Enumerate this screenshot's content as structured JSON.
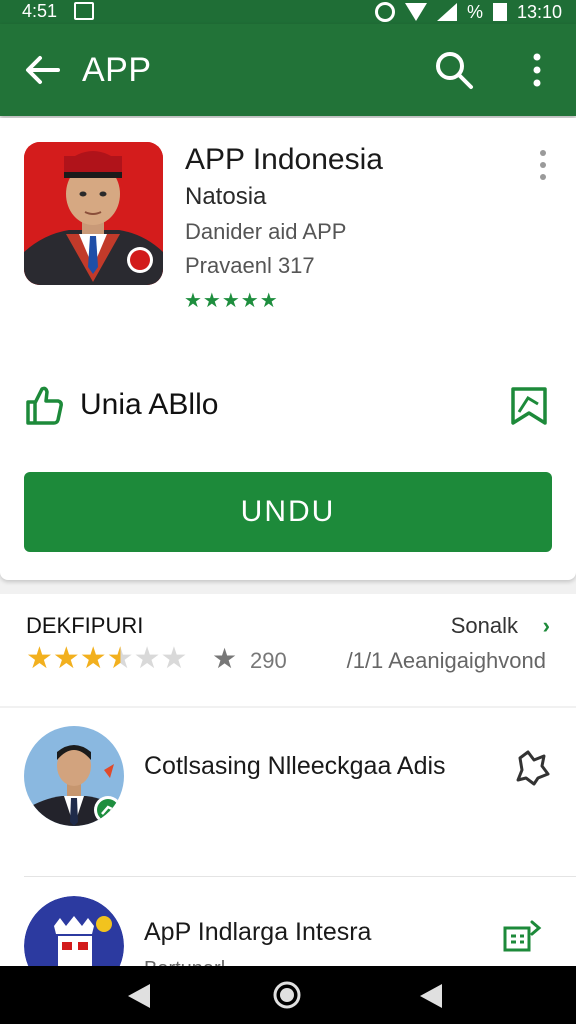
{
  "status_bar": {
    "left_time": "4:51",
    "right_time": "13:10",
    "battery_percent": "%"
  },
  "app_bar": {
    "title": "APP"
  },
  "app_info": {
    "name": "APP Indonesia",
    "developer": "Natosia",
    "subtitle_1": "Danider aid APP",
    "subtitle_2": "Pravaenl 317",
    "star_rating": "★★★★★",
    "like_label": "Unia ABllo",
    "install_label": "UNDU"
  },
  "ratings": {
    "heading": "DEKFIPURI",
    "see_all": "Sonalk",
    "chevron": "›",
    "stars_on": "★★★",
    "star_half": "★",
    "stars_off": "★★",
    "count_star": "★",
    "count": "290",
    "age": "/1/1 Aeanigaighvond"
  },
  "list": {
    "items": [
      {
        "label": "Cotlsasing Nlleeckgaa Adis",
        "action_icon": "puzzle-icon"
      },
      {
        "label": "ApP Indlarga Intesra",
        "sub_label": "Bartunarl",
        "action_icon": "share-icon"
      }
    ]
  },
  "colors": {
    "primary": "#227338",
    "accent": "#1d8a3a",
    "star": "#f2b01e"
  }
}
